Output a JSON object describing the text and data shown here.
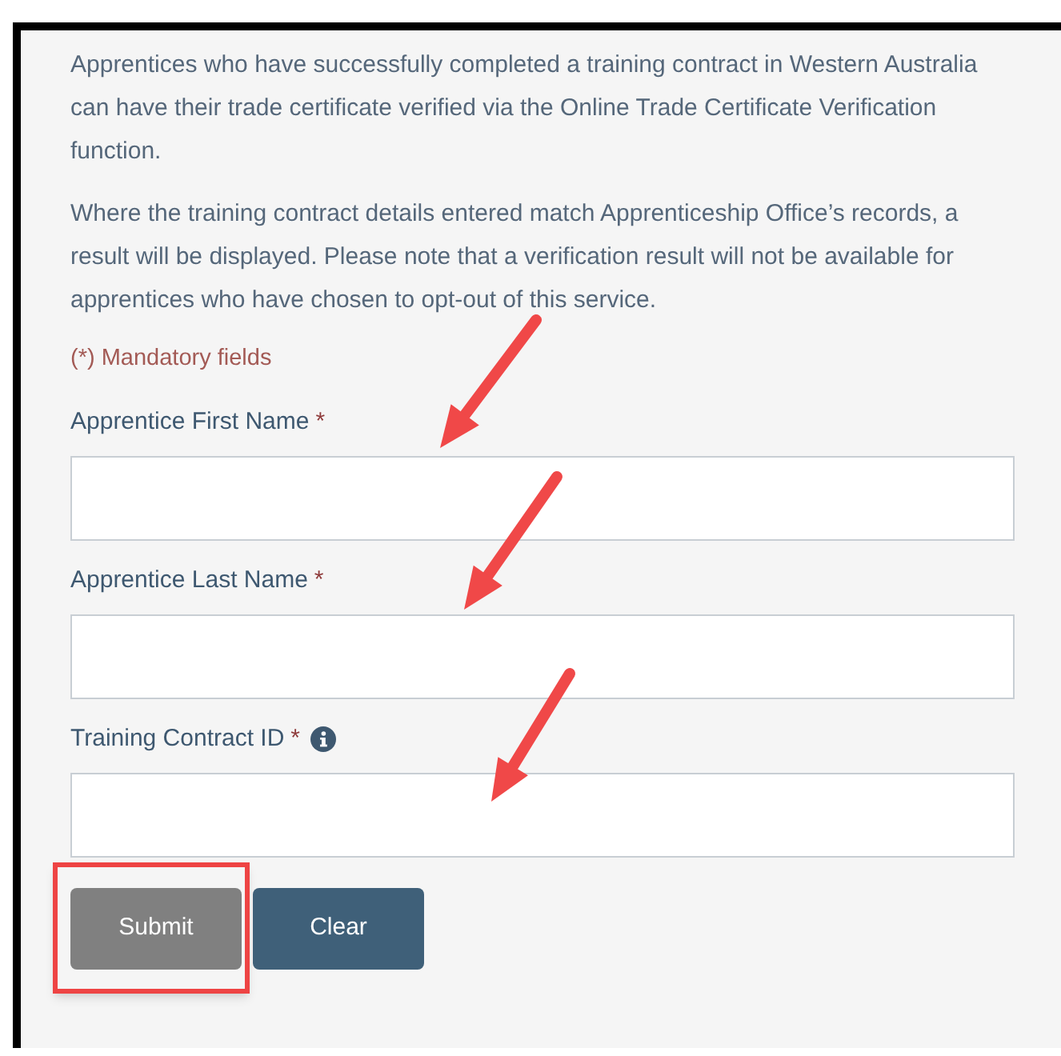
{
  "paragraphs": [
    "Apprentices who have successfully completed a training contract in Western Australia can have their trade certificate verified via the Online Trade Certificate Verification function.",
    "Where the training contract details entered match Apprenticeship Office’s records, a result will be displayed. Please note that a verification result will not be available for apprentices who have chosen to opt-out of this service."
  ],
  "mandatory_note": "(*) Mandatory fields",
  "fields": [
    {
      "label": "Apprentice First Name",
      "required_mark": "*",
      "info_icon": false,
      "arrow": true
    },
    {
      "label": "Apprentice Last Name",
      "required_mark": "*",
      "info_icon": false,
      "arrow": true
    },
    {
      "label": "Training Contract ID",
      "required_mark": "*",
      "info_icon": true,
      "arrow": true
    }
  ],
  "buttons": [
    {
      "label": "Submit",
      "kind": "submit",
      "highlighted": true
    },
    {
      "label": "Clear",
      "kind": "clear",
      "highlighted": false
    }
  ]
}
